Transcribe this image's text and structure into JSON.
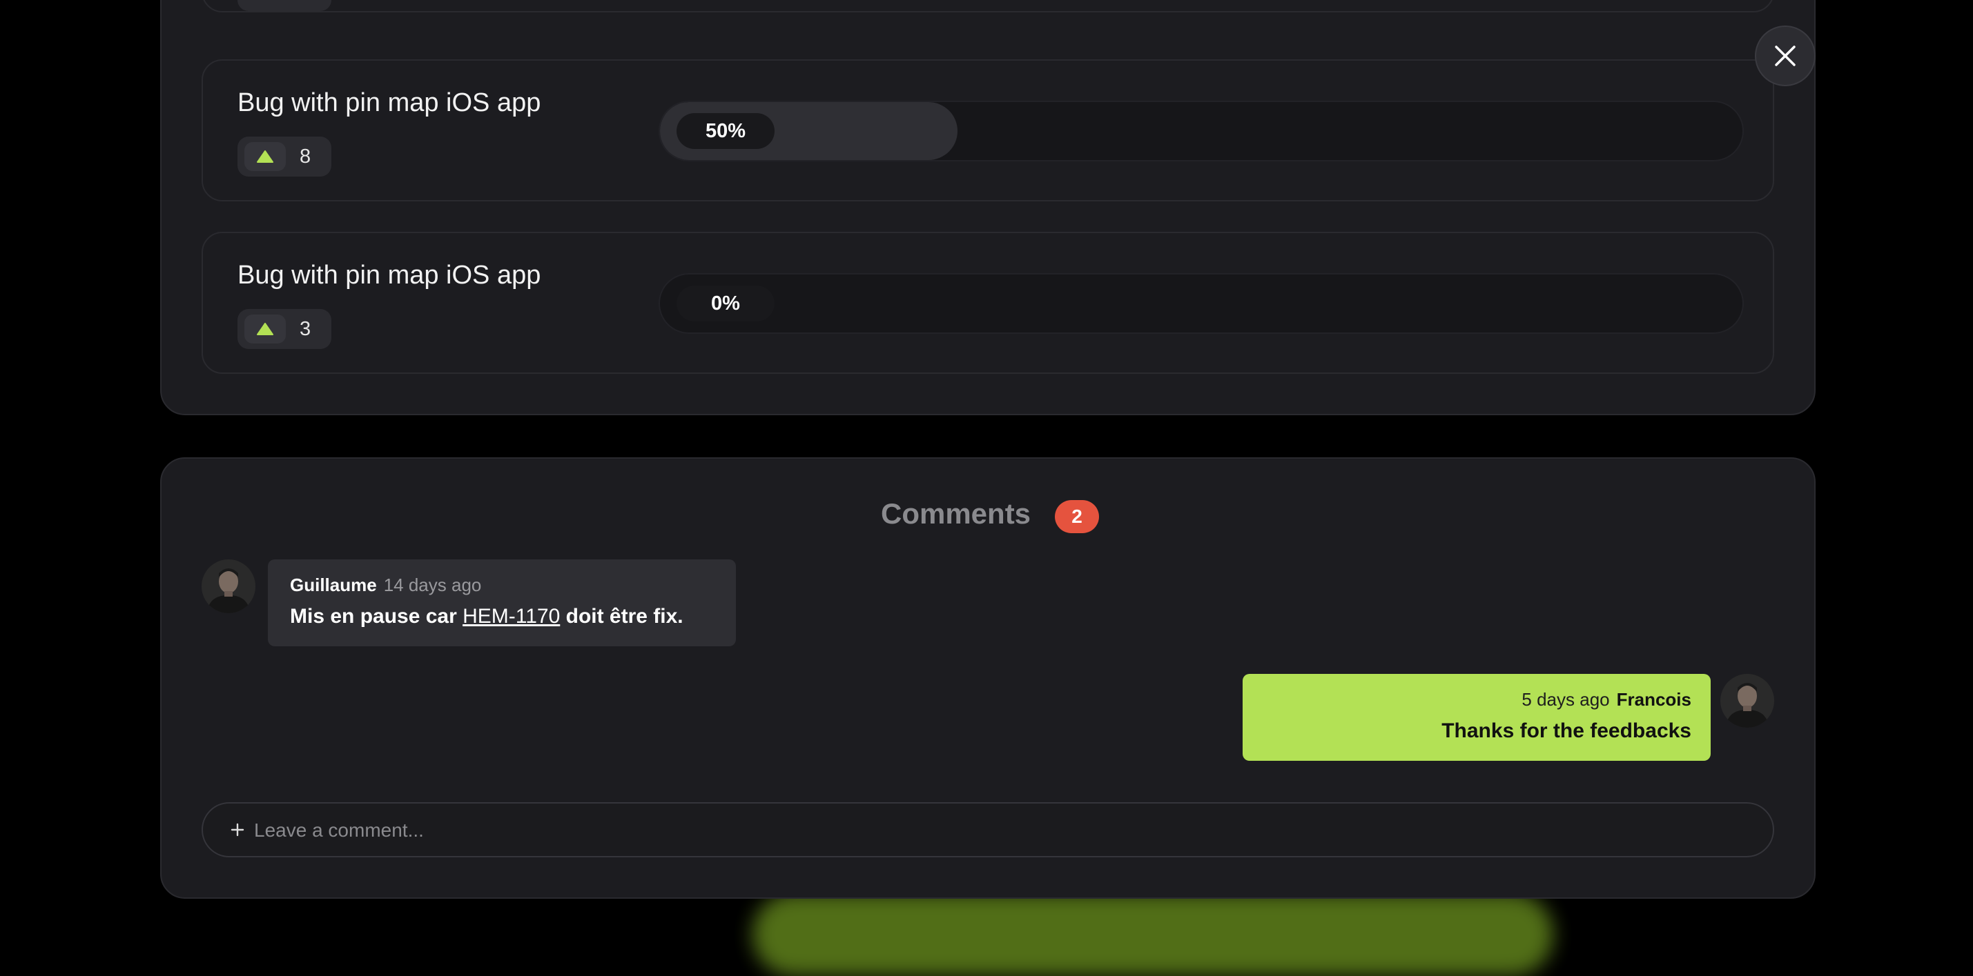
{
  "close_label": "close",
  "tasks": [
    {
      "title": "",
      "votes": "",
      "progress_label": "",
      "progress": 0
    },
    {
      "title": "Bug with pin map iOS app",
      "votes": "8",
      "progress_label": "50%",
      "progress": 0.5
    },
    {
      "title": "Bug with pin map iOS app",
      "votes": "3",
      "progress_label": "0%",
      "progress": 0.0
    }
  ],
  "comments": {
    "title": "Comments",
    "count": "2",
    "items": [
      {
        "author": "Guillaume",
        "time": "14 days ago",
        "message_prefix": "Mis en pause car ",
        "link": "HEM-1170",
        "message_suffix": " doit être fix."
      },
      {
        "author": "Francois",
        "time": "5 days ago",
        "message": "Thanks for the feedbacks"
      }
    ],
    "input_placeholder": "Leave a comment..."
  },
  "colors": {
    "accent": "#b3e155",
    "badge": "#e5533e",
    "panel": "#1c1c20",
    "background": "#000000"
  },
  "icons": {
    "close": "close-icon",
    "upvote": "triangle-up-icon",
    "plus": "plus-icon"
  }
}
